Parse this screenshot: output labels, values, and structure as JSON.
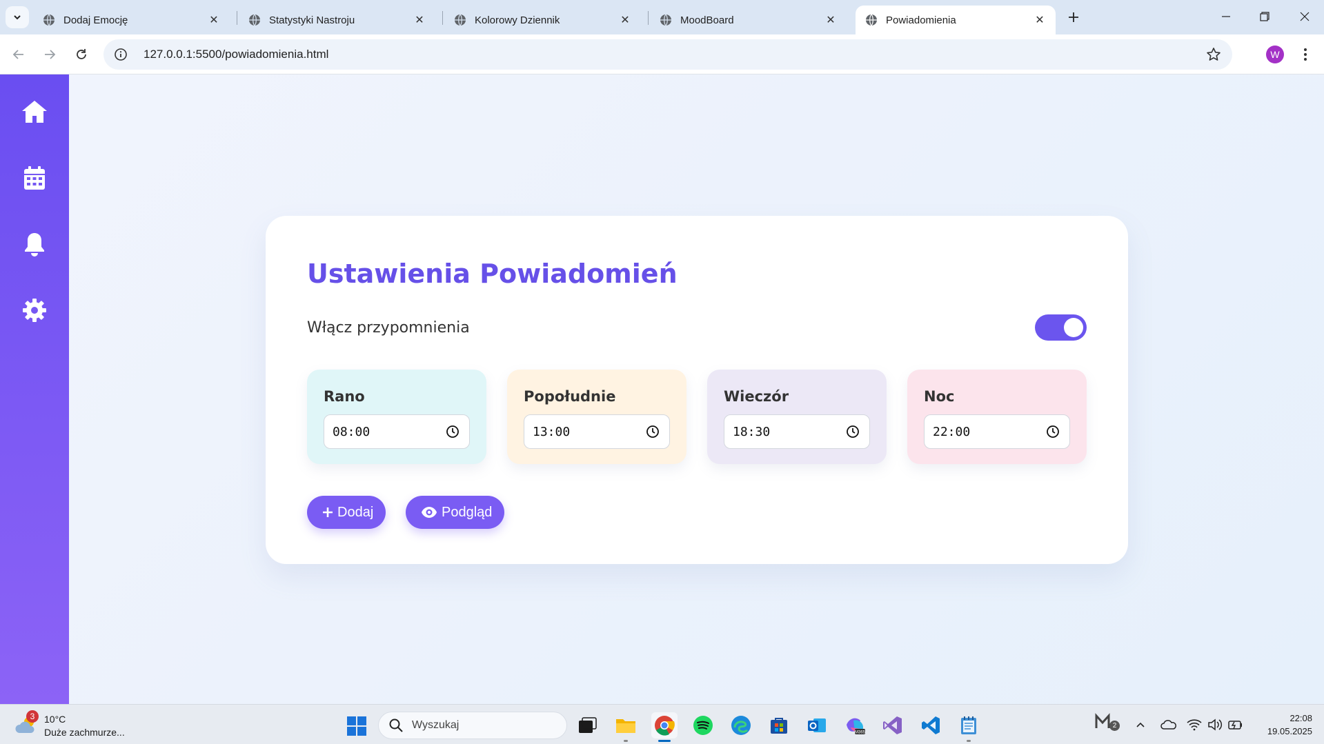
{
  "browser": {
    "tabs": [
      {
        "label": "Dodaj Emocję"
      },
      {
        "label": "Statystyki Nastroju"
      },
      {
        "label": "Kolorowy Dziennik"
      },
      {
        "label": "MoodBoard"
      },
      {
        "label": "Powiadomienia"
      }
    ],
    "active_tab_index": 4,
    "url": "127.0.0.1:5500/powiadomienia.html",
    "profile_initial": "W"
  },
  "sidebar": {
    "items": [
      {
        "icon": "home-icon"
      },
      {
        "icon": "calendar-icon"
      },
      {
        "icon": "bell-icon"
      },
      {
        "icon": "gear-icon"
      }
    ]
  },
  "settings": {
    "title": "Ustawienia Powiadomień",
    "toggle_label": "Włącz przypomnienia",
    "toggle_on": true,
    "times": [
      {
        "label": "Rano",
        "value": "08:00",
        "color": "#e0f6f8"
      },
      {
        "label": "Popołudnie",
        "value": "13:00",
        "color": "#fff3e2"
      },
      {
        "label": "Wieczór",
        "value": "18:30",
        "color": "#ece8f6"
      },
      {
        "label": "Noc",
        "value": "22:00",
        "color": "#fce4ec"
      }
    ],
    "add_button": "Dodaj",
    "preview_button": "Podgląd",
    "accent_color": "#6650e8"
  },
  "taskbar": {
    "weather_badge": "3",
    "weather_temp": "10°C",
    "weather_desc": "Duże zachmurze...",
    "search_placeholder": "Wyszukaj",
    "tray_badge": "2",
    "time": "22:08",
    "date": "19.05.2025"
  }
}
